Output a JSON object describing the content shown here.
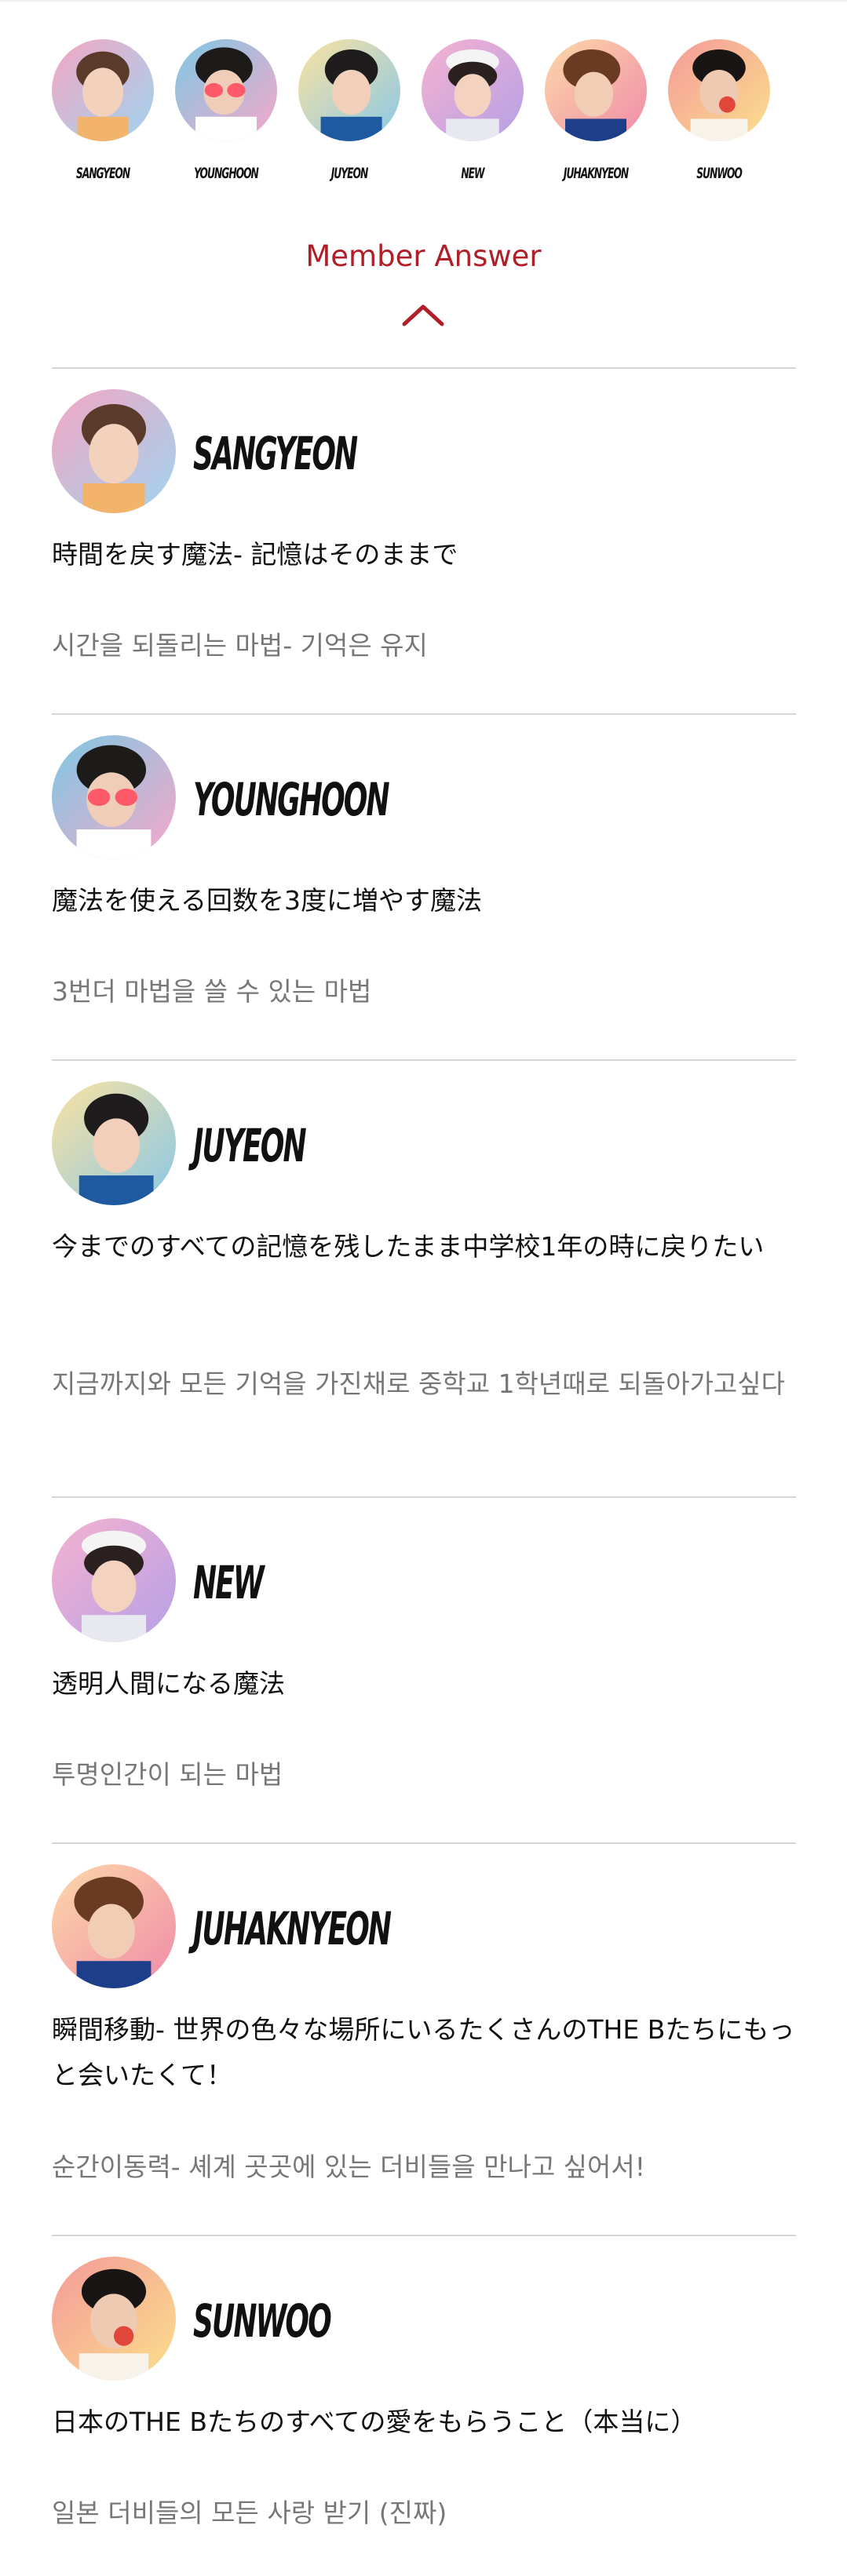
{
  "top_members": [
    {
      "name": "SANGYEON"
    },
    {
      "name": "YOUNGHOON"
    },
    {
      "name": "JUYEON"
    },
    {
      "name": "NEW"
    },
    {
      "name": "JUHAKNYEON"
    },
    {
      "name": "SUNWOO"
    }
  ],
  "toggle": {
    "title": "Member Answer",
    "icon": "chevron-up-icon",
    "accent_color": "#b01e28"
  },
  "answers": [
    {
      "name": "SANGYEON",
      "ja": "時間を戻す魔法- 記憶はそのままで",
      "ko": "시간을 되돌리는 마법- 기억은 유지"
    },
    {
      "name": "YOUNGHOON",
      "ja": "魔法を使える回数を3度に増やす魔法",
      "ko": "3번더 마법을 쓸 수 있는 마법"
    },
    {
      "name": "JUYEON",
      "ja": "今までのすべての記憶を残したまま中学校1年の時に戻りたい",
      "ko": "지금까지와 모든 기억을 가진채로 중학교 1학년때로 되돌아가고싶다"
    },
    {
      "name": "NEW",
      "ja": "透明人間になる魔法",
      "ko": "투명인간이 되는 마법"
    },
    {
      "name": "JUHAKNYEON",
      "ja": "瞬間移動- 世界の色々な場所にいるたくさんのTHE Bたちにもっと会いたくて！",
      "ko": "순간이동력- 셰계 곳곳에 있는 더비들을 만나고 싶어서!"
    },
    {
      "name": "SUNWOO",
      "ja": "日本のTHE Bたちのすべての愛をもらうこと（本当に）",
      "ko": "일본 더비들의 모든 사랑 받기 (진짜)"
    }
  ]
}
